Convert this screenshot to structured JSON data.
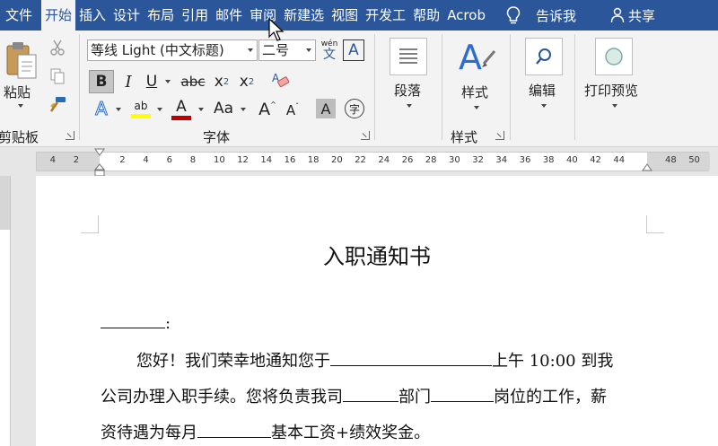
{
  "menu": {
    "tabs": [
      "文件",
      "开始",
      "插入",
      "设计",
      "布局",
      "引用",
      "邮件",
      "审阅",
      "新建选",
      "视图",
      "开发工",
      "帮助",
      "Acrob"
    ],
    "active_index": 1,
    "tell_me": "告诉我",
    "share": "共享"
  },
  "ribbon": {
    "clipboard": {
      "paste": "粘贴",
      "label": "剪贴板"
    },
    "font": {
      "name": "等线 Light (中文标题)",
      "size": "二号",
      "wen": "wén",
      "wen2": "文",
      "bold": "B",
      "italic": "I",
      "underline": "U",
      "strike": "abc",
      "sub": "x",
      "sup": "x",
      "sub_mark": "2",
      "sup_mark": "2",
      "text_effects": "A",
      "highlight": "ab",
      "font_color": "A",
      "case": "Aa",
      "grow": "A",
      "shrink": "A",
      "shade": "A",
      "enclose": "字",
      "char_border": "A",
      "label": "字体"
    },
    "paragraph": {
      "label": "段落"
    },
    "styles": {
      "button": "样式",
      "label": "样式"
    },
    "editing": {
      "label": "编辑"
    },
    "print_preview": {
      "label": "打印预览"
    }
  },
  "ruler": {
    "left_numbers": [
      "4",
      "2"
    ],
    "right_numbers": [
      "2",
      "4",
      "6",
      "8",
      "10",
      "12",
      "14",
      "16",
      "18",
      "20",
      "22",
      "24",
      "26",
      "28",
      "30",
      "32",
      "34",
      "36",
      "38",
      "40",
      "42",
      "44"
    ],
    "far_numbers": [
      "48",
      "50"
    ]
  },
  "document": {
    "title": "入职通知书",
    "salutation_colon": ":",
    "para1_a": "您好！我们荣幸地通知您于",
    "para1_b": "上午 10:00 到我",
    "para2_a": "公司办理入职手续。您将负责我司",
    "para2_b": "部门",
    "para2_c": "岗位的工作，薪",
    "para3_a": "资待遇为每月",
    "para3_b": "基本工资+绩效奖金。"
  },
  "colors": {
    "accent": "#2b579a",
    "ribbon_bg": "#f3f3f3",
    "highlight_yellow": "#ffff00",
    "font_red": "#c00000"
  }
}
